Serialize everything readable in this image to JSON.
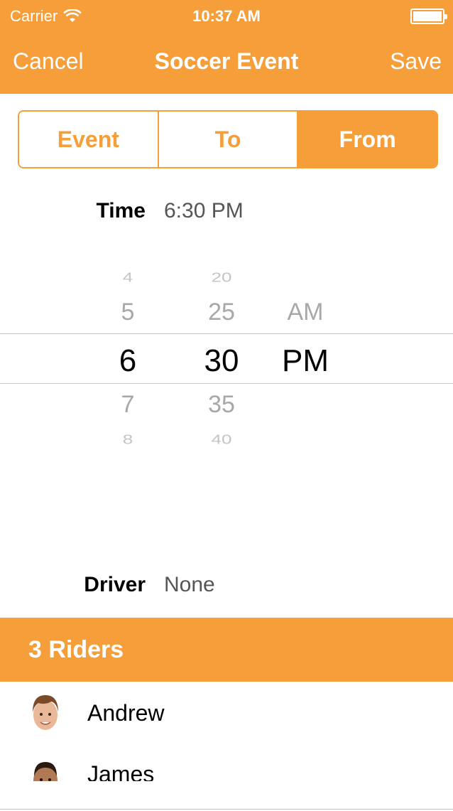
{
  "status_bar": {
    "carrier": "Carrier",
    "time": "10:37 AM",
    "wifi_icon": "wifi-icon",
    "battery_icon": "battery-icon"
  },
  "nav": {
    "cancel": "Cancel",
    "title": "Soccer Event",
    "save": "Save"
  },
  "segments": [
    {
      "label": "Event",
      "active": false
    },
    {
      "label": "To",
      "active": false
    },
    {
      "label": "From",
      "active": true
    }
  ],
  "time_field": {
    "label": "Time",
    "value": "6:30 PM"
  },
  "picker": {
    "hours": [
      "4",
      "5",
      "6",
      "7",
      "8"
    ],
    "minutes": [
      "20",
      "25",
      "30",
      "35",
      "40"
    ],
    "periods": [
      "AM",
      "PM"
    ],
    "selected": {
      "hour": "6",
      "minute": "30",
      "period": "PM"
    }
  },
  "driver_field": {
    "label": "Driver",
    "value": "None"
  },
  "riders": {
    "header": "3 Riders",
    "items": [
      {
        "name": "Andrew"
      },
      {
        "name": "James"
      }
    ]
  },
  "colors": {
    "accent": "#f59e3a",
    "text_gray": "#555555",
    "picker_fade": "#a8a8a8",
    "separator": "#c8c7cc"
  }
}
